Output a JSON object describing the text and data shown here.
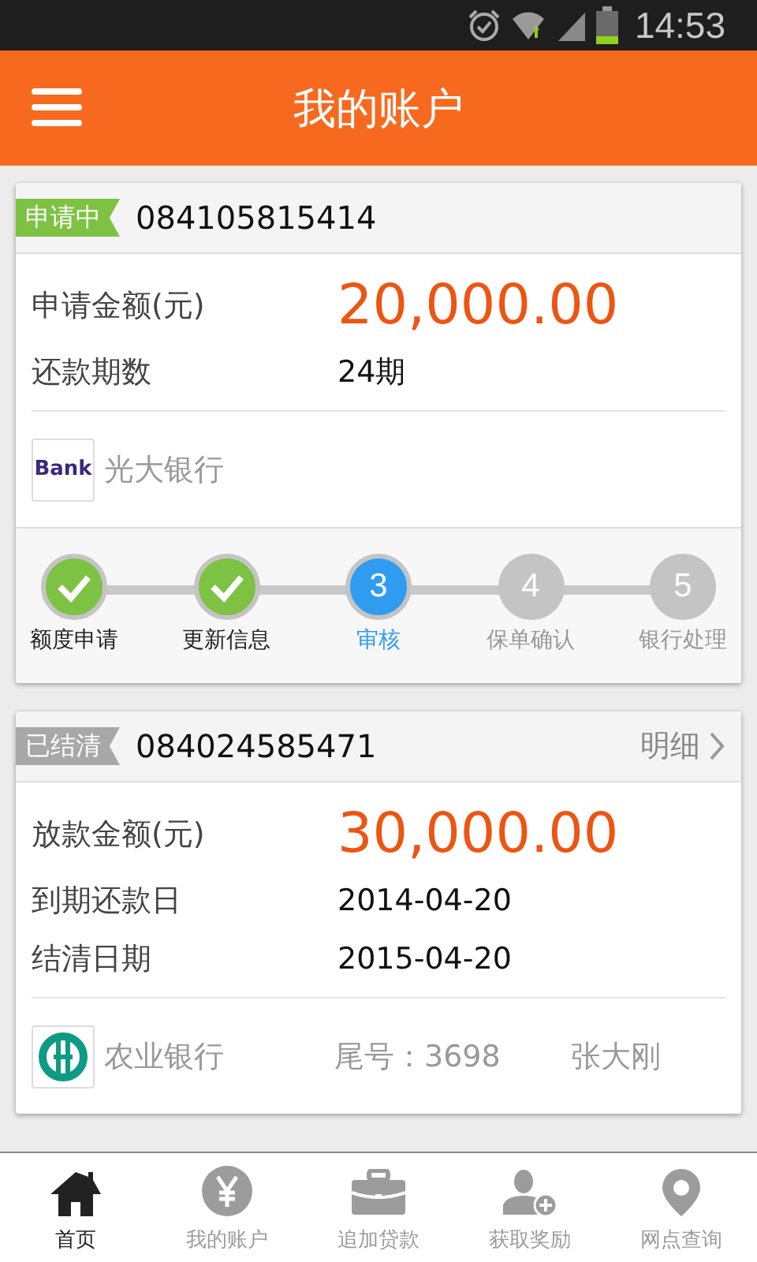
{
  "status_bar": {
    "time": "14:53"
  },
  "header": {
    "title": "我的账户"
  },
  "cards": [
    {
      "tag": {
        "label": "申请中",
        "color": "#7dc242"
      },
      "number": "084105815414",
      "fields": [
        {
          "label": "申请金额(元)",
          "value": "20,000.00",
          "kind": "amount"
        },
        {
          "label": "还款期数",
          "value": "24期",
          "kind": "plain"
        }
      ],
      "bank": {
        "kind": "bank",
        "logo_text": "Bank",
        "name": "光大银行"
      },
      "steps": [
        {
          "label": "额度申请",
          "kind": "done"
        },
        {
          "label": "更新信息",
          "kind": "done"
        },
        {
          "label": "审核",
          "number": "3",
          "kind": "current"
        },
        {
          "label": "保单确认",
          "number": "4",
          "kind": "pending"
        },
        {
          "label": "银行处理",
          "number": "5",
          "kind": "pending"
        }
      ]
    },
    {
      "tag": {
        "label": "已结清",
        "color": "#a8a8a8"
      },
      "number": "084024585471",
      "detail_link": "明细",
      "fields": [
        {
          "label": "放款金额(元)",
          "value": "30,000.00",
          "kind": "amount"
        },
        {
          "label": "到期还款日",
          "value": "2014-04-20",
          "kind": "plain"
        },
        {
          "label": "结清日期",
          "value": "2015-04-20",
          "kind": "plain"
        }
      ],
      "bank": {
        "kind": "abc",
        "name": "农业银行",
        "account": "尾号：3698",
        "holder": "张大刚"
      }
    }
  ],
  "nav": [
    {
      "label": "首页",
      "selected": true
    },
    {
      "label": "我的账户",
      "selected": false
    },
    {
      "label": "追加贷款",
      "selected": false
    },
    {
      "label": "获取奖励",
      "selected": false
    },
    {
      "label": "网点查询",
      "selected": false
    }
  ]
}
